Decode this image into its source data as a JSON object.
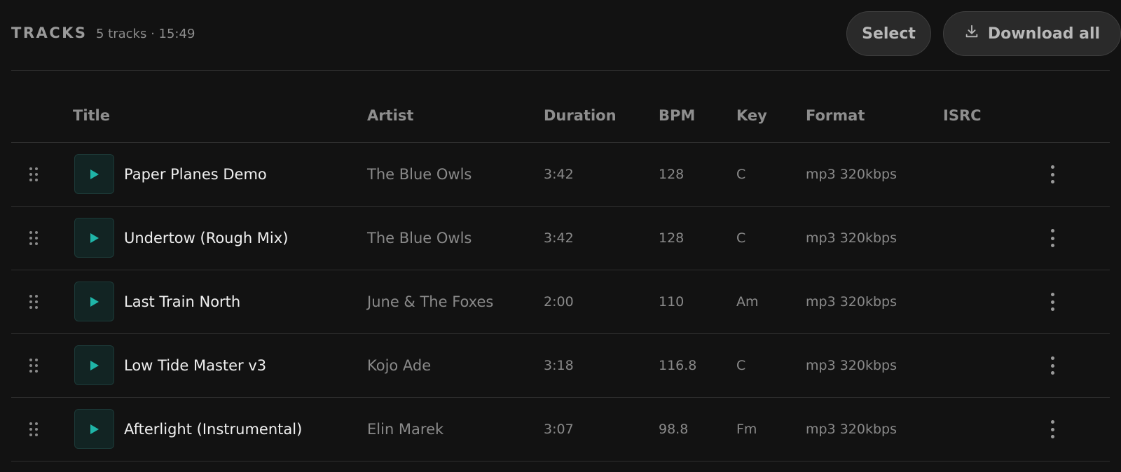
{
  "header": {
    "title": "TRACKS",
    "meta": "5 tracks · 15:49",
    "select_label": "Select",
    "download_all_label": "Download all"
  },
  "columns": {
    "title": "Title",
    "artist": "Artist",
    "duration": "Duration",
    "bpm": "BPM",
    "key": "Key",
    "format": "Format",
    "isrc": "ISRC"
  },
  "tracks": [
    {
      "title": "Paper Planes Demo",
      "artist": "The Blue Owls",
      "duration": "3:42",
      "bpm": "128",
      "key": "C",
      "format": "mp3 320kbps",
      "isrc": ""
    },
    {
      "title": "Undertow (Rough Mix)",
      "artist": "The Blue Owls",
      "duration": "3:42",
      "bpm": "128",
      "key": "C",
      "format": "mp3 320kbps",
      "isrc": ""
    },
    {
      "title": "Last Train North",
      "artist": "June & The Foxes",
      "duration": "2:00",
      "bpm": "110",
      "key": "Am",
      "format": "mp3 320kbps",
      "isrc": ""
    },
    {
      "title": "Low Tide Master v3",
      "artist": "Kojo Ade",
      "duration": "3:18",
      "bpm": "116.8",
      "key": "C",
      "format": "mp3 320kbps",
      "isrc": ""
    },
    {
      "title": "Afterlight (Instrumental)",
      "artist": "Elin Marek",
      "duration": "3:07",
      "bpm": "98.8",
      "key": "Fm",
      "format": "mp3 320kbps",
      "isrc": ""
    }
  ],
  "icons": {
    "download": "download-icon",
    "drag": "drag-handle-icon",
    "play": "play-icon",
    "more": "more-vertical-icon"
  },
  "colors": {
    "background": "#121212",
    "accent": "#1fb5a8",
    "play_bg": "#122423"
  }
}
